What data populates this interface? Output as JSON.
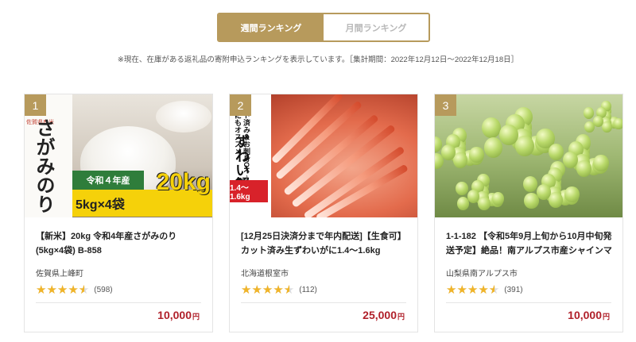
{
  "tabs": [
    {
      "label": "週間ランキング",
      "active": true
    },
    {
      "label": "月間ランキング",
      "active": false
    }
  ],
  "note": "※現在、在庫がある返礼品の寄附申込ランキングを表示しています。［集計期間：2022年12月12日〜2022年12月18日］",
  "colors": {
    "accent": "#b79a5c",
    "price": "#b0202a",
    "star": "#f0b429"
  },
  "items": [
    {
      "rank": "1",
      "title": "【新米】20kg 令和4年産さがみのり (5kg×4袋) B-858",
      "prefecture": "佐賀県上峰町",
      "rating": 4.5,
      "review_count": "(598)",
      "price": "10,000",
      "yen": "円",
      "image": {
        "kome": "米",
        "saga": "佐賀県産米",
        "vertical": "さがみのり",
        "green": "令和４年産",
        "yellow": "5kg×4袋",
        "big": "20kg"
      }
    },
    {
      "rank": "2",
      "title": "[12月25日決済分まで年内配送]【生食可】カット済み生ずわいがに1.4〜1.6kg",
      "prefecture": "北海道根室市",
      "rating": 4.5,
      "review_count": "(112)",
      "price": "25,000",
      "yen": "円",
      "image": {
        "vertical": "カット済み＆お刺身OK♪ お鍋にもオススメ",
        "big": "ずわい蟹",
        "red": "1.4〜1.6kg"
      }
    },
    {
      "rank": "3",
      "title": "1-1-182 【令和5年9月上旬から10月中旬発送予定】絶品！南アルプス市産シャインマスカット",
      "prefecture": "山梨県南アルプス市",
      "rating": 4.5,
      "review_count": "(391)",
      "price": "10,000",
      "yen": "円",
      "image": {}
    }
  ]
}
